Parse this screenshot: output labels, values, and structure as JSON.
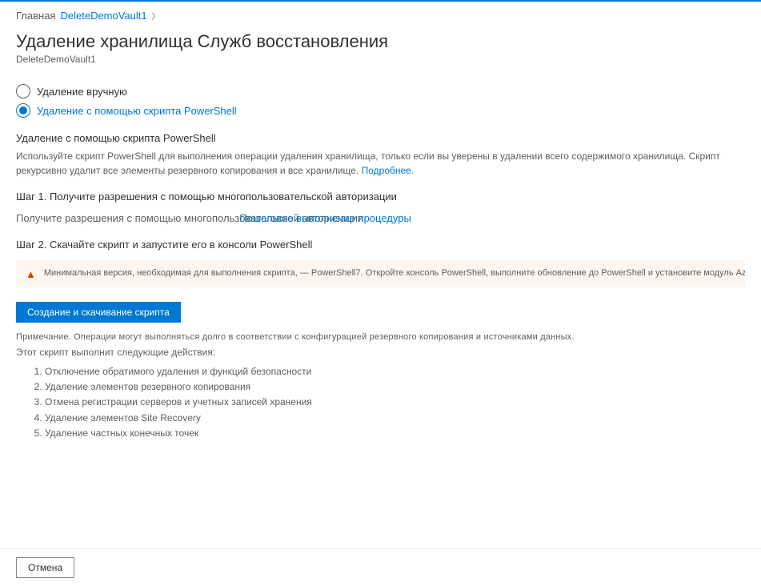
{
  "breadcrumb": {
    "home": "Главная",
    "vault": "DeleteDemoVault1"
  },
  "page": {
    "title": "Удаление хранилища Служб восстановления",
    "subtitle": "DeleteDemoVault1"
  },
  "radio": {
    "manual": "Удаление вручную",
    "powershell": "Удаление с помощью скрипта PowerShell"
  },
  "section": {
    "heading": "Удаление с помощью скрипта PowerShell",
    "desc_part1": "Используйте скрипт PowerShell для выполнения операции удаления хранилища, только если вы уверены в удалении всего содержимого хранилища. Скрипт рекурсивно удалит все элементы резервного копирования и все хранилище. ",
    "learn_more": "Подробнее."
  },
  "step1": {
    "heading": "Шаг 1. Получите разрешения с помощью многопользовательской авторизации",
    "desc_base": "Получите разрешения с помощью многопольз",
    "desc_overlap_under": "овательской авторизации.",
    "desc_overlap_link": "Пошаговое выполнение процедуры"
  },
  "step2": {
    "heading": "Шаг 2. Скачайте скрипт и запустите его в консоли PowerShell"
  },
  "warning": {
    "text": "Минимальная версия, необходимая для выполнения скрипта, — PowerShell7. Откройте консоль PowerShell, выполните обновление до PowerShell и установите модуль Az, запустив команды, указанные"
  },
  "button": {
    "generate": "Создание и скачивание скрипта",
    "cancel": "Отмена"
  },
  "note": "Примечание. Операции могут выполняться долго в соответствии с конфигурацией резервного копирования и источниками данных.",
  "script_intro": "Этот скрипт выполнит следующие действия:",
  "script_list": [
    "Отключение обратимого удаления и функций безопасности",
    "Удаление элементов резервного копирования",
    "Отмена регистрации серверов и учетных записей хранения",
    "Удаление элементов Site Recovery",
    "Удаление частных конечных точек"
  ]
}
